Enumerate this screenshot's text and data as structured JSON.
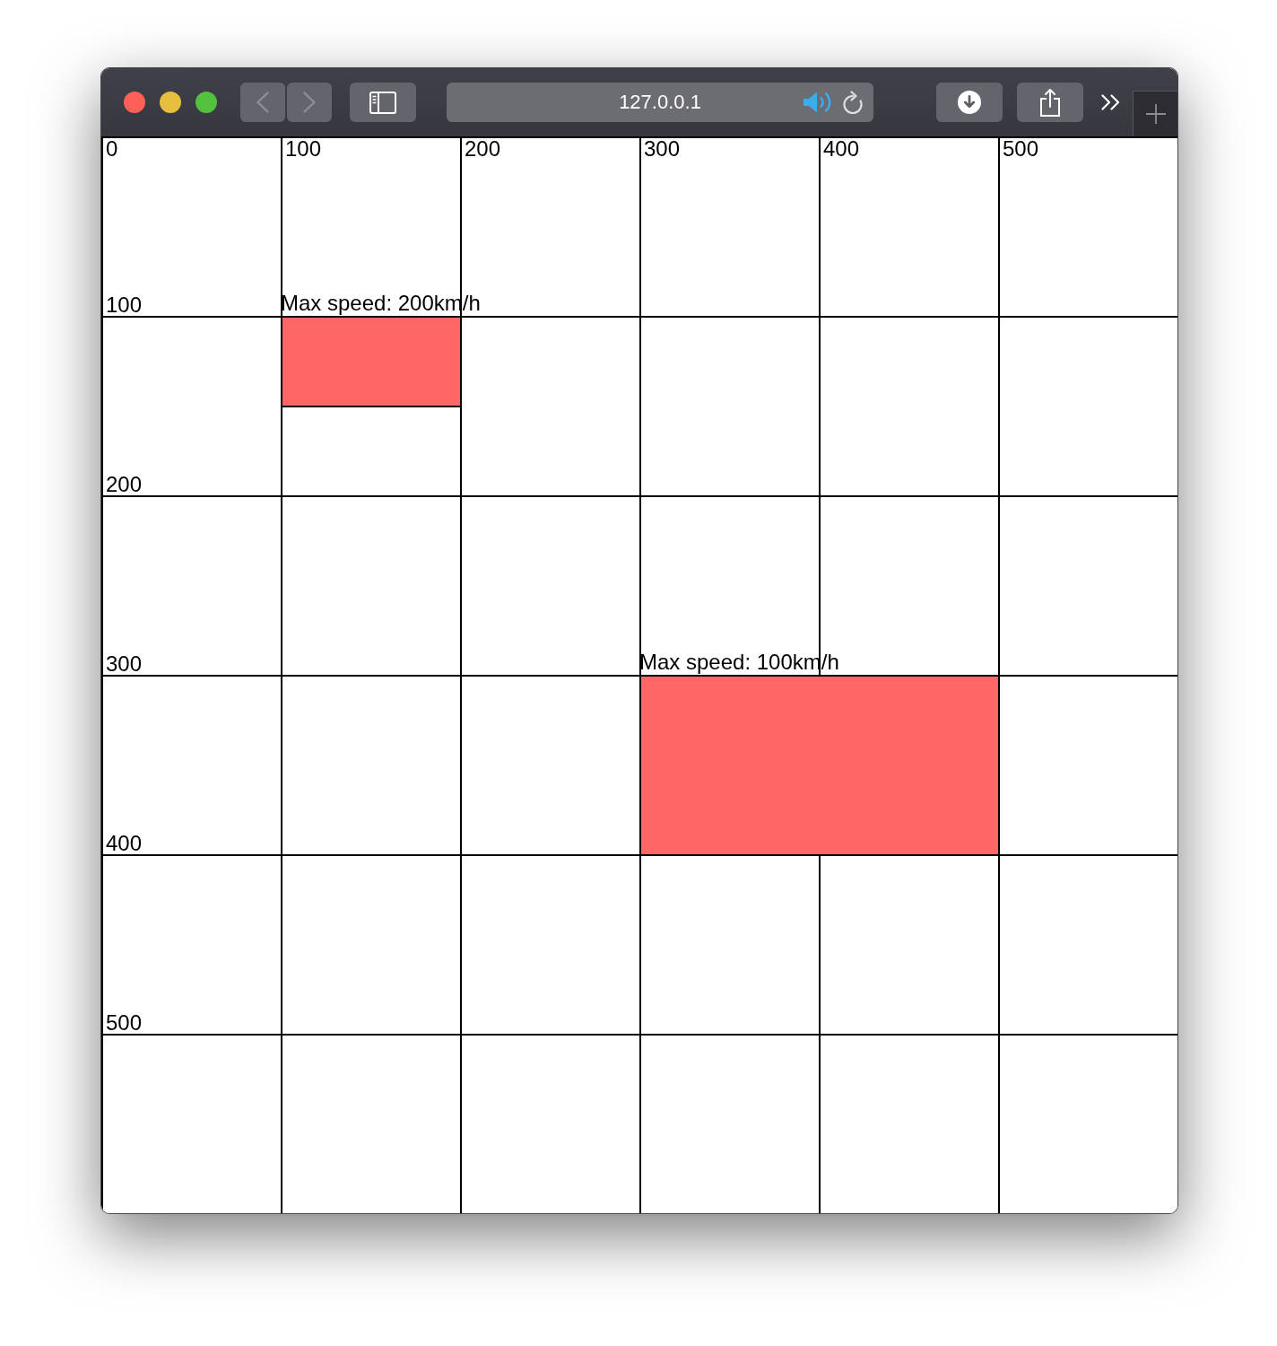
{
  "browser": {
    "address": "127.0.0.1"
  },
  "canvas": {
    "x_axis_labels": [
      "0",
      "100",
      "200",
      "300",
      "400",
      "500"
    ],
    "y_axis_labels": [
      "100",
      "200",
      "300",
      "400",
      "500"
    ],
    "zones": [
      {
        "label": "Max speed: 200km/h"
      },
      {
        "label": "Max speed: 100km/h"
      }
    ]
  }
}
